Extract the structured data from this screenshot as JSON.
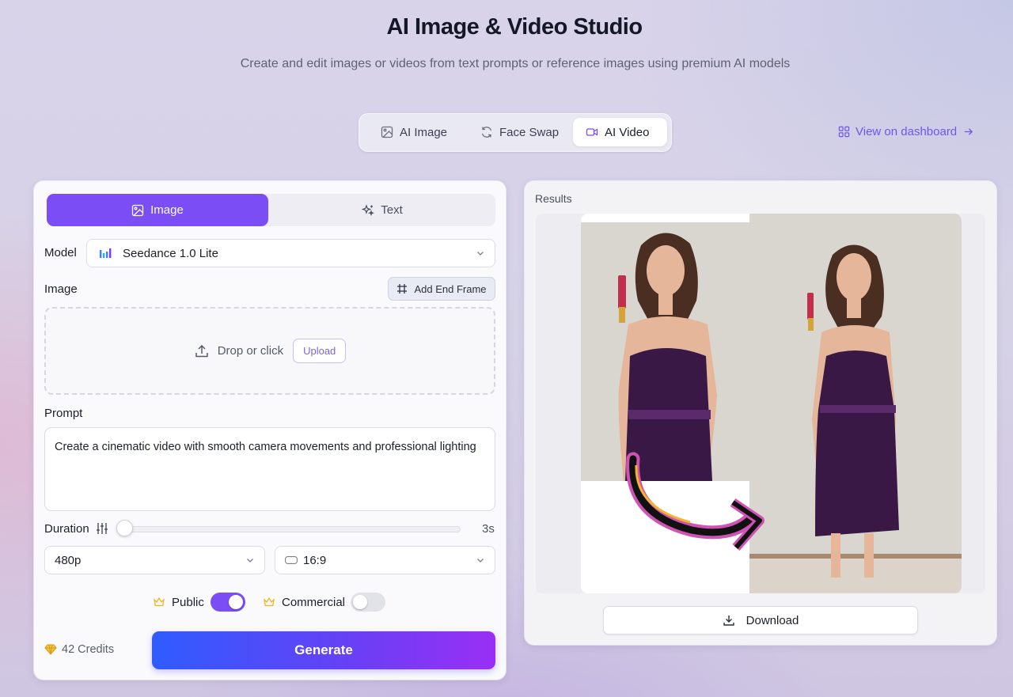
{
  "header": {
    "title": "AI Image & Video Studio",
    "subtitle": "Create and edit images or videos from text prompts or reference images using premium AI models"
  },
  "mode_tabs": [
    {
      "label": "AI Image",
      "icon": "image-icon",
      "active": false
    },
    {
      "label": "Face Swap",
      "icon": "refresh-icon",
      "active": false
    },
    {
      "label": "AI Video",
      "icon": "video-icon",
      "active": true
    }
  ],
  "dashboard_link": {
    "label": "View on dashboard",
    "icon": "grid-icon"
  },
  "input_tabs": [
    {
      "label": "Image",
      "icon": "image-icon",
      "active": true
    },
    {
      "label": "Text",
      "icon": "sparkle-icon",
      "active": false
    }
  ],
  "model": {
    "label": "Model",
    "value": "Seedance 1.0 Lite",
    "icon": "bar-chart-icon"
  },
  "image_section": {
    "label": "Image",
    "end_frame_button": "Add End Frame",
    "drop_text": "Drop or click",
    "upload_button": "Upload"
  },
  "prompt": {
    "label": "Prompt",
    "value": "Create a cinematic video with smooth camera movements and professional lighting"
  },
  "duration": {
    "label": "Duration",
    "value": "3s",
    "slider_fraction": 0.0
  },
  "resolution": {
    "value": "480p"
  },
  "aspect_ratio": {
    "value": "16:9"
  },
  "toggles": {
    "public": {
      "label": "Public",
      "on": true
    },
    "commercial": {
      "label": "Commercial",
      "on": false
    }
  },
  "credits": {
    "label": "42 Credits"
  },
  "generate_button": "Generate",
  "results": {
    "title": "Results",
    "download_label": "Download"
  },
  "colors": {
    "accent": "#7b4df5",
    "link": "#6d56f0",
    "crown": "#f0b429"
  }
}
